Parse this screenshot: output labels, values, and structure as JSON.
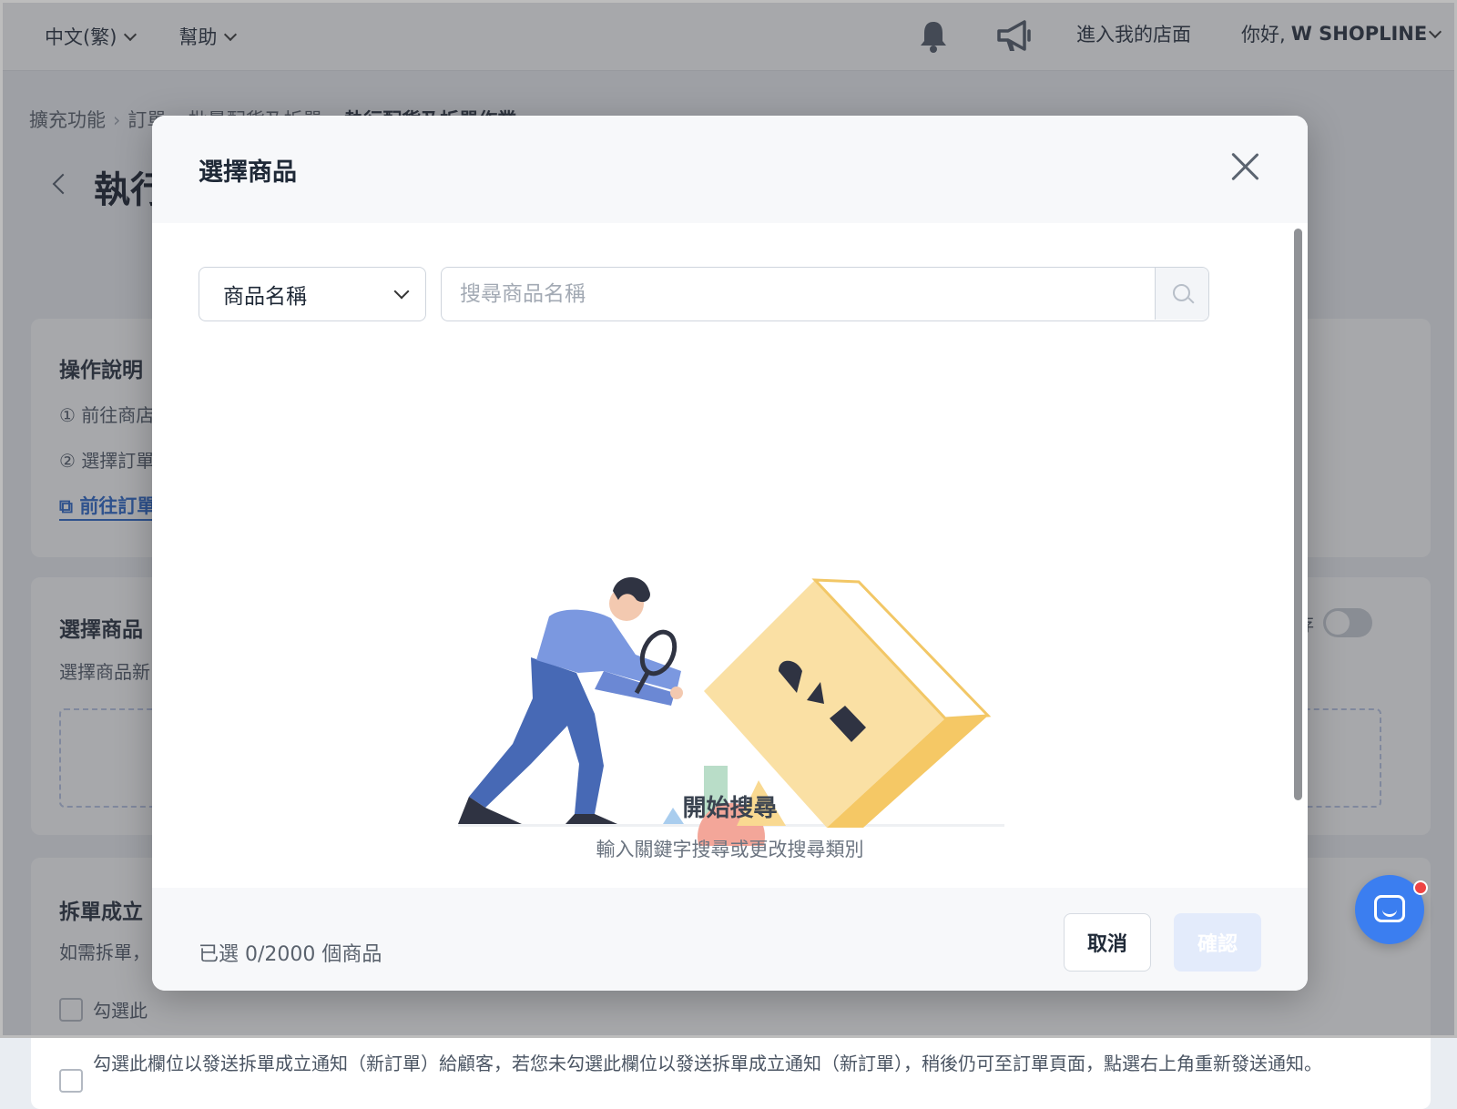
{
  "header": {
    "language": "中文(繁)",
    "help": "幫助",
    "store_link": "進入我的店面",
    "greeting_prefix": "你好,",
    "store_name": "W SHOPLINE"
  },
  "page": {
    "breadcrumb": [
      "擴充功能",
      "訂單",
      "批量配貨及拆單",
      "執行配貨及拆單作業"
    ],
    "breadcrumb_sep": "›",
    "title": "執行配貨及拆單作業",
    "instructions": {
      "title": "操作說明",
      "step1": "① 前往商店",
      "step2": "② 選擇訂單",
      "link": "前往訂單"
    },
    "select_products": {
      "title": "選擇商品",
      "desc": "選擇商品新",
      "stock_label": "庫存"
    },
    "split": {
      "title": "拆單成立",
      "desc": "如需拆單，",
      "option1": "勾選此",
      "option2": "勾選此欄位以發送拆單成立通知（新訂單）給顧客，若您未勾選此欄位以發送拆單成立通知（新訂單），稍後仍可至訂單頁面，點選右上角重新發送通知。"
    }
  },
  "modal": {
    "title": "選擇商品",
    "filter_selected": "商品名稱",
    "search_placeholder": "搜尋商品名稱",
    "empty_title": "開始搜尋",
    "empty_subtitle": "輸入關鍵字搜尋或更改搜尋類別",
    "selected_count": "已選 0/2000 個商品",
    "cancel": "取消",
    "confirm": "確認"
  },
  "icons": {
    "bell": "bell-icon",
    "megaphone": "megaphone-icon",
    "close": "close-icon",
    "search": "search-icon",
    "chat": "chat-icon"
  },
  "colors": {
    "accent": "#3b7ef0",
    "link": "#2563c9",
    "confirm_disabled": "#e3ebfb"
  }
}
